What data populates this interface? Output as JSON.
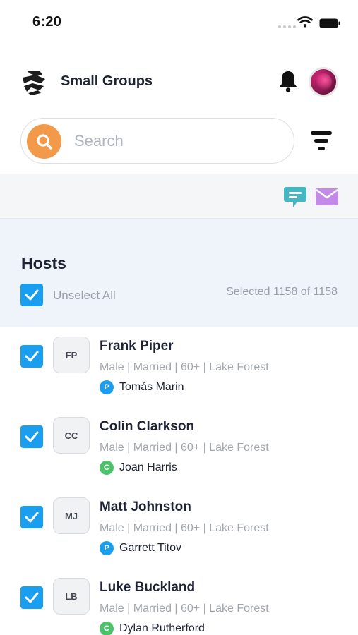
{
  "status_bar": {
    "time": "6:20"
  },
  "header": {
    "title": "Small Groups"
  },
  "search": {
    "placeholder": "Search",
    "value": ""
  },
  "hosts": {
    "title": "Hosts",
    "unselect_label": "Unselect All",
    "selected_text": "Selected 1158 of 1158",
    "items": [
      {
        "initials": "FP",
        "name": "Frank Piper",
        "meta": "Male | Married | 60+ | Lake Forest",
        "partner_badge": "P",
        "partner_badge_color": "#1a9ff0",
        "partner_name": "Tomás Marin"
      },
      {
        "initials": "CC",
        "name": "Colin Clarkson",
        "meta": "Male | Married | 60+ | Lake Forest",
        "partner_badge": "C",
        "partner_badge_color": "#4cc26b",
        "partner_name": "Joan Harris"
      },
      {
        "initials": "MJ",
        "name": "Matt Johnston",
        "meta": "Male | Married | 60+ | Lake Forest",
        "partner_badge": "P",
        "partner_badge_color": "#1a9ff0",
        "partner_name": "Garrett Titov"
      },
      {
        "initials": "LB",
        "name": "Luke Buckland",
        "meta": "Male | Married | 60+ | Lake Forest",
        "partner_badge": "C",
        "partner_badge_color": "#4cc26b",
        "partner_name": "Dylan Rutherford"
      }
    ]
  },
  "colors": {
    "accent_blue": "#1a9ff0",
    "search_orange": "#f2994a",
    "chat_teal": "#45b7c4",
    "mail_purple": "#c48ae8",
    "badge_green": "#4cc26b"
  },
  "icons": [
    "logo-icon",
    "bell-icon",
    "avatar",
    "search-icon",
    "filter-icon",
    "chat-icon",
    "mail-icon",
    "checkbox-checked-icon"
  ]
}
